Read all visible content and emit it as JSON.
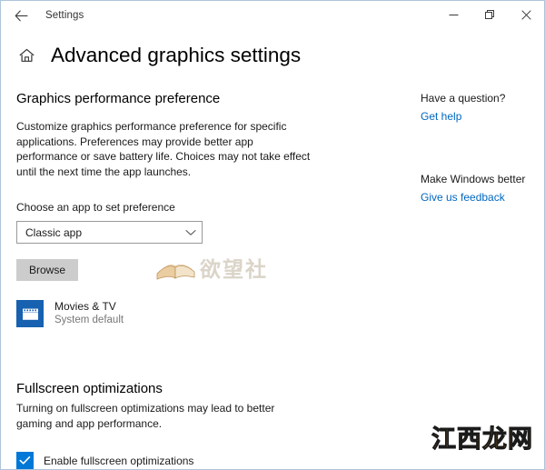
{
  "window": {
    "title": "Settings",
    "back_icon": "back-arrow-icon",
    "controls": {
      "minimize": "minimize-icon",
      "restore": "restore-icon",
      "close": "close-icon"
    }
  },
  "header": {
    "home_icon": "home-icon",
    "title": "Advanced graphics settings"
  },
  "main": {
    "graphics_section": {
      "title": "Graphics performance preference",
      "description": "Customize graphics performance preference for specific applications. Preferences may provide better app performance or save battery life. Choices may not take effect until the next time the app launches.",
      "choose_label": "Choose an app to set preference",
      "dropdown": {
        "value": "Classic app",
        "chevron_icon": "chevron-down-icon"
      },
      "browse_label": "Browse",
      "app_entry": {
        "icon": "movies-tv-icon",
        "name": "Movies & TV",
        "status": "System default"
      }
    },
    "fullscreen_section": {
      "title": "Fullscreen optimizations",
      "description": "Turning on fullscreen optimizations may lead to better gaming and app performance.",
      "checkbox": {
        "label": "Enable fullscreen optimizations",
        "checked": true,
        "icon": "checkmark-icon"
      }
    }
  },
  "sidebar": {
    "question_heading": "Have a question?",
    "question_link": "Get help",
    "feedback_heading": "Make Windows better",
    "feedback_link": "Give us feedback"
  },
  "watermarks": {
    "center": "欲望社",
    "center_icon": "open-book-icon",
    "bottom_right": "江西龙网"
  },
  "colors": {
    "accent": "#0078d7",
    "link": "#0067c0",
    "app_tile": "#1761b0",
    "button_face": "#cccccc"
  }
}
